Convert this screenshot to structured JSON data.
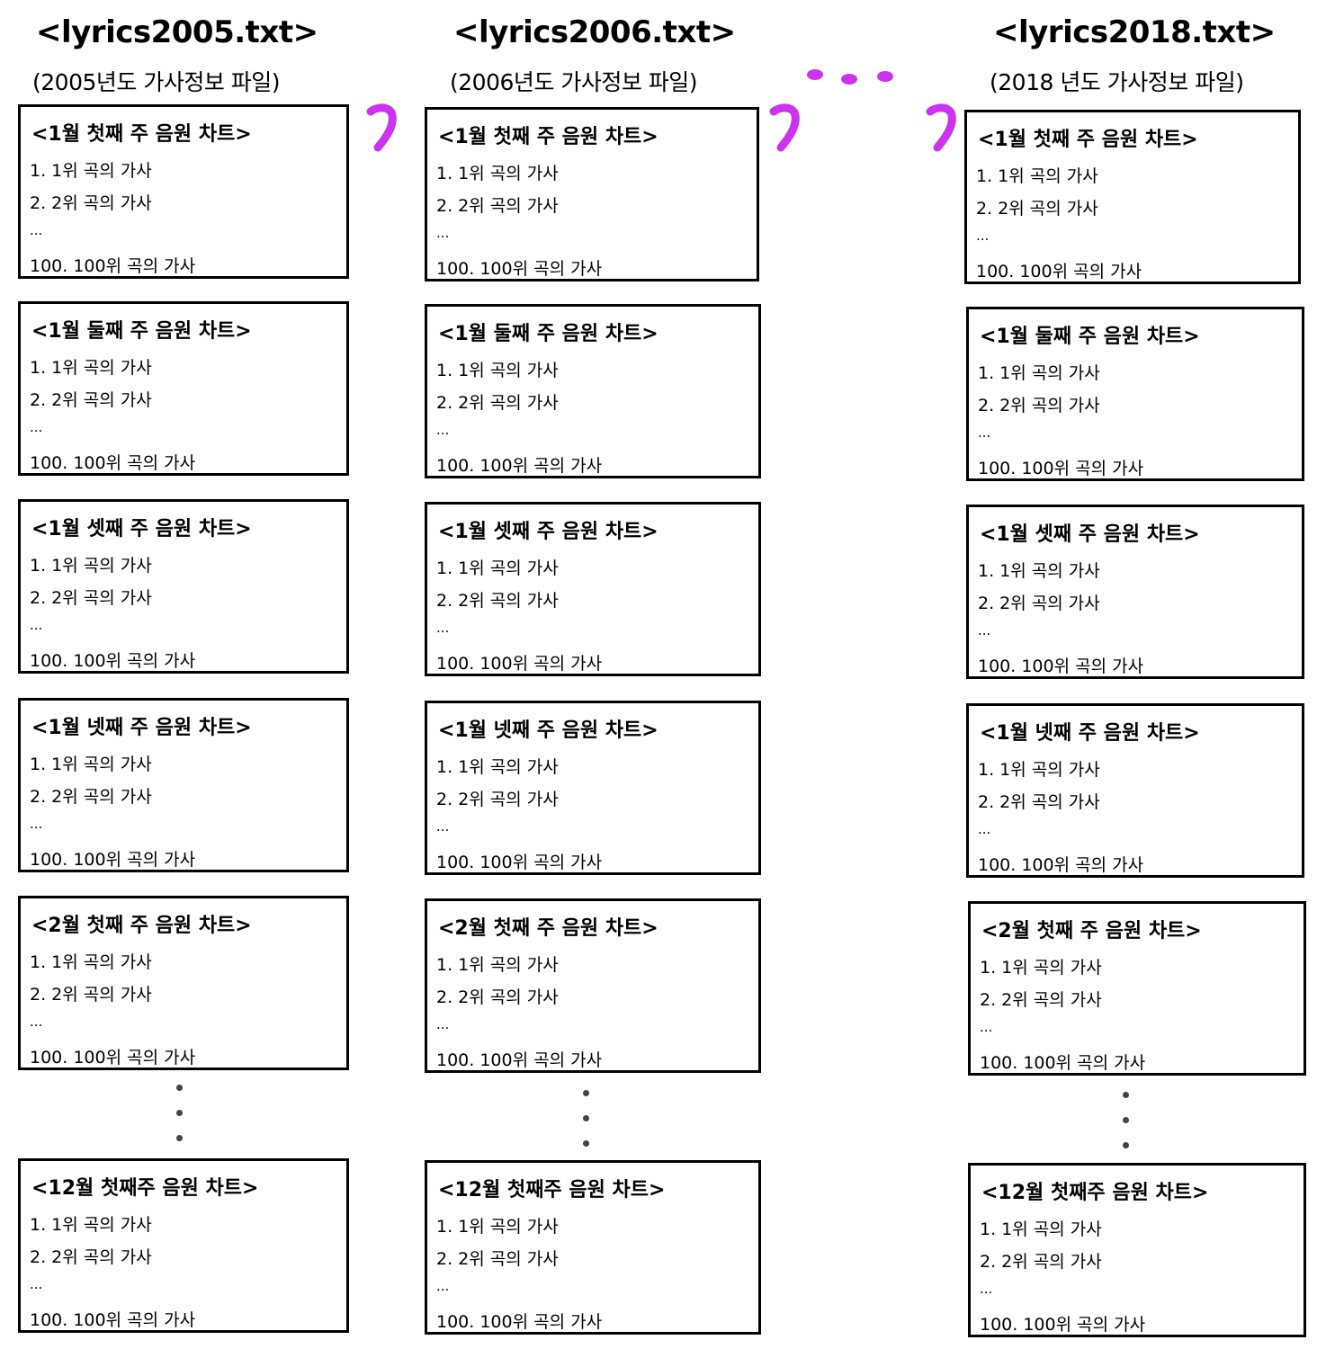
{
  "files": [
    {
      "title": "<lyrics2005.txt>",
      "subtitle": "(2005년도 가사정보 파일)",
      "charts": [
        "<1월 첫째 주 음원 차트>",
        "<1월 둘째 주 음원 차트>",
        "<1월 셋째 주 음원 차트>",
        "<1월 넷째 주 음원 차트>",
        "<2월 첫째 주 음원 차트>",
        "<12월 첫째주 음원 차트>"
      ]
    },
    {
      "title": "<lyrics2006.txt>",
      "subtitle": "(2006년도 가사정보 파일)",
      "charts": [
        "<1월 첫째 주 음원 차트>",
        "<1월 둘째 주 음원 차트>",
        "<1월 셋째 주 음원 차트>",
        "<1월 넷째 주 음원 차트>",
        "<2월 첫째 주 음원 차트>",
        "<12월 첫째주 음원 차트>"
      ]
    },
    {
      "title": "<lyrics2018.txt>",
      "subtitle": "(2018 년도 가사정보 파일)",
      "charts": [
        "<1월 첫째 주 음원 차트>",
        "<1월 둘째 주 음원 차트>",
        "<1월 셋째 주 음원 차트>",
        "<1월 넷째 주 음원 차트>",
        "<2월 첫째 주 음원 차트>",
        "<12월 첫째주 음원 차트>"
      ]
    }
  ],
  "entries": {
    "line1": "1. 1위 곡의 가사",
    "line2": "2. 2위 곡의 가사",
    "ellipsis": "...",
    "last": "100. 100위 곡의 가사"
  },
  "colors": {
    "accent": "#cc33ee",
    "border": "#000000"
  }
}
